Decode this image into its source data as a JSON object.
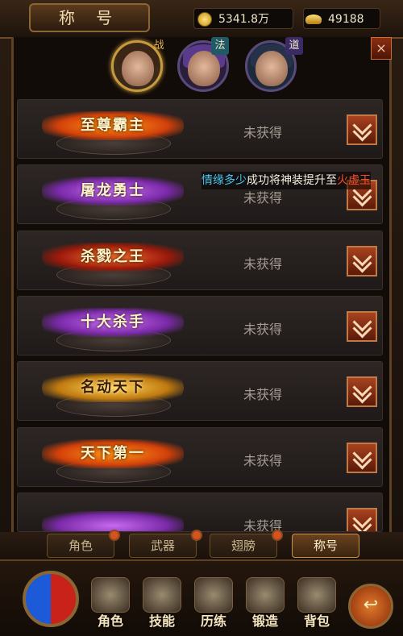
{
  "header": {
    "title": "称 号",
    "gold_icon": "gold-coin-icon",
    "gold_value": "5341.8万",
    "ingot_icon": "gold-ingot-icon",
    "ingot_value": "49188"
  },
  "characters": [
    {
      "tag": "战",
      "selected": true
    },
    {
      "tag": "法",
      "selected": false
    },
    {
      "tag": "道",
      "selected": false
    }
  ],
  "announcement": {
    "part1": "情缘多少",
    "part2": "成功将神装提升至",
    "part3": "火虚玉"
  },
  "titles": [
    {
      "name": "至尊霸主",
      "status": "未获得",
      "style": "fire"
    },
    {
      "name": "屠龙勇士",
      "status": "未获得",
      "style": "purple"
    },
    {
      "name": "杀戮之王",
      "status": "未获得",
      "style": "red"
    },
    {
      "name": "十大杀手",
      "status": "未获得",
      "style": "purple"
    },
    {
      "name": "名动天下",
      "status": "未获得",
      "style": "gold"
    },
    {
      "name": "天下第一",
      "status": "未获得",
      "style": "fire"
    },
    {
      "name": "",
      "status": "未获得",
      "style": "purple"
    }
  ],
  "tabs": [
    "角色",
    "武器",
    "翅膀",
    "称号"
  ],
  "active_tab": "称号",
  "nav": [
    "角色",
    "技能",
    "历练",
    "锻造",
    "背包"
  ],
  "close_label": "×",
  "back_label": "↩"
}
